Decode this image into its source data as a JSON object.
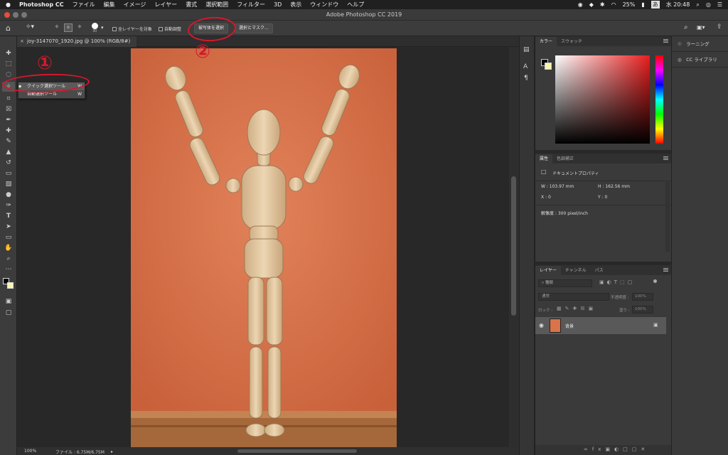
{
  "menubar": {
    "apple": "",
    "app": "Photoshop CC",
    "items": [
      "ファイル",
      "編集",
      "イメージ",
      "レイヤー",
      "書式",
      "選択範囲",
      "フィルター",
      "3D",
      "表示",
      "ウィンドウ",
      "ヘルプ"
    ],
    "battery": "25%",
    "input_method": "あ",
    "clock": "水 20:48"
  },
  "window": {
    "title": "Adobe Photoshop CC 2019"
  },
  "options_bar": {
    "brush_size": "30",
    "sample_all_layers": "全レイヤーを対象",
    "auto_enhance": "自動調整",
    "select_subject": "被写体を選択",
    "select_mask": "選択とマスク..."
  },
  "document": {
    "tab_title": "joy-3147070_1920.jpg @ 100% (RGB/8#)",
    "close": "×",
    "zoom": "100%",
    "file_info": "ファイル : 6.75M/6.75M"
  },
  "tool_flyout": {
    "items": [
      {
        "label": "クイック選択ツール",
        "key": "W"
      },
      {
        "label": "自動選択ツール",
        "key": "W"
      }
    ]
  },
  "annotations": {
    "one": "①",
    "two": "②"
  },
  "color_panel": {
    "tabs": [
      "カラー",
      "スウォッチ"
    ]
  },
  "properties_panel": {
    "tabs": [
      "属性",
      "色調補正"
    ],
    "section": "ドキュメントプロパティ",
    "w": "W : 103.97 mm",
    "h": "H : 162.56 mm",
    "x": "X : 0",
    "y": "Y : 0",
    "resolution": "解像度 : 300 pixel/inch"
  },
  "layers_panel": {
    "tabs": [
      "レイヤー",
      "チャンネル",
      "パス"
    ],
    "filter_label": "種類",
    "blend_mode": "通常",
    "opacity_label": "不透明度 :",
    "opacity_value": "100%",
    "lock_label": "ロック :",
    "fill_label": "塗り :",
    "fill_value": "100%",
    "layer_name": "背景"
  },
  "libraries": {
    "learn": "ラーニング",
    "cc_libraries": "CC ライブラリ"
  },
  "colors": {
    "annotation_red": "#d4182c",
    "canvas_orange": "#d9734a",
    "wood": "#e3c9a2"
  }
}
